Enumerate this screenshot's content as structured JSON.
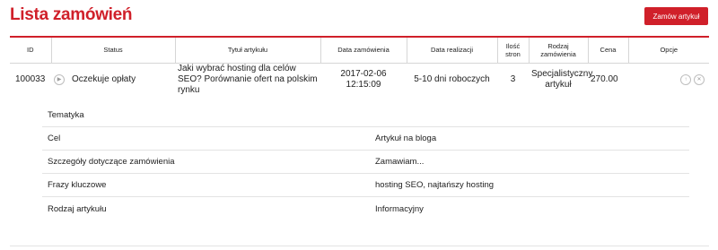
{
  "header": {
    "title": "Lista zamówień",
    "order_button": "Zamów artykuł"
  },
  "table": {
    "columns": [
      "ID",
      "Status",
      "Tytuł artykułu",
      "Data zamówienia",
      "Data realizacji",
      "Ilość stron",
      "Rodzaj zamówienia",
      "Cena",
      "Opcje"
    ],
    "rows": [
      {
        "id": "100033",
        "status": "Oczekuje opłaty",
        "title": "Jaki wybrać hosting dla celów SEO? Porównanie ofert na polskim rynku",
        "order_date": "2017-02-06 12:15:09",
        "completion": "5-10 dni roboczych",
        "pages": "3",
        "type": "Specjalistyczny artykuł",
        "price": "270.00"
      }
    ]
  },
  "details": [
    {
      "label": "Tematyka",
      "value": ""
    },
    {
      "label": "Cel",
      "value": "Artykuł na bloga"
    },
    {
      "label": "Szczegóły dotyczące zamówienia",
      "value": "Zamawiam..."
    },
    {
      "label": "Frazy kluczowe",
      "value": "hosting SEO, najtańszy hosting"
    },
    {
      "label": "Rodzaj artykułu",
      "value": "Informacyjny"
    }
  ],
  "icons": {
    "expand": "play-icon",
    "upload": "arrow-up-icon",
    "cancel": "close-icon"
  },
  "colors": {
    "accent": "#d0202a"
  }
}
